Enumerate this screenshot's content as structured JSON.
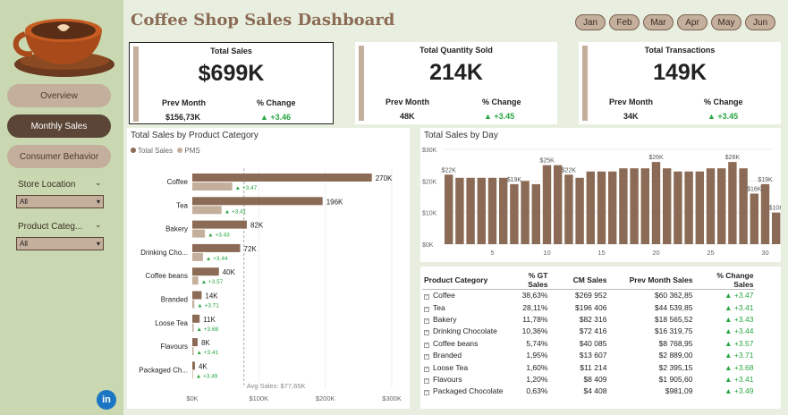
{
  "header": {
    "title": "Coffee Shop Sales Dashboard"
  },
  "months": [
    "Jan",
    "Feb",
    "Mar",
    "Apr",
    "May",
    "Jun"
  ],
  "nav": {
    "overview": "Overview",
    "monthly": "Monthly Sales",
    "behavior": "Consumer Behavior"
  },
  "filters": {
    "store": {
      "label": "Store Location",
      "value": "All"
    },
    "category": {
      "label": "Product Categ...",
      "value": "All"
    }
  },
  "social": {
    "icon": "linkedin-icon",
    "label": "in"
  },
  "kpis": [
    {
      "title": "Total Sales",
      "value": "$699K",
      "prev_label": "Prev Month",
      "prev_value": "$156,73K",
      "change_label": "% Change",
      "change_value": "▲ +3.46"
    },
    {
      "title": "Total Quantity Sold",
      "value": "214K",
      "prev_label": "Prev Month",
      "prev_value": "48K",
      "change_label": "% Change",
      "change_value": "▲ +3.45"
    },
    {
      "title": "Total Transactions",
      "value": "149K",
      "prev_label": "Prev Month",
      "prev_value": "34K",
      "change_label": "% Change",
      "change_value": "▲ +3.45"
    }
  ],
  "colors": {
    "total": "#8b6b55",
    "pms": "#c4ae9c",
    "up": "#2aa642",
    "sidebar": "#c9d8b0",
    "accent": "#5a4537"
  },
  "chart_data": [
    {
      "type": "bar",
      "title": "Total Sales by Product Category",
      "legend": [
        "Total Sales",
        "PMS"
      ],
      "categories": [
        "Coffee",
        "Tea",
        "Bakery",
        "Drinking Cho...",
        "Coffee beans",
        "Branded",
        "Loose Tea",
        "Flavours",
        "Packaged Ch..."
      ],
      "series": [
        {
          "name": "Total Sales",
          "values": [
            270,
            196,
            82,
            72,
            40,
            14,
            11,
            8,
            4
          ]
        },
        {
          "name": "PMS",
          "values": [
            60,
            44,
            19,
            16,
            9,
            3,
            2,
            2,
            1
          ]
        }
      ],
      "value_labels": [
        "270K",
        "196K",
        "82K",
        "72K",
        "40K",
        "14K",
        "11K",
        "8K",
        "4K"
      ],
      "change_labels": [
        "▲ +3.47",
        "▲ +3.41",
        "▲ +3.43",
        "▲ +3.44",
        "▲ +3.57",
        "▲ +3.71",
        "▲ +3.68",
        "▲ +3.41",
        "▲ +3.49"
      ],
      "xticks": [
        "$0K",
        "$100K",
        "$200K",
        "$300K"
      ],
      "xlim": [
        0,
        300
      ],
      "avg_line": {
        "value": 77.65,
        "label": "Avg Sales: $77,65K"
      }
    },
    {
      "type": "bar",
      "title": "Total Sales by Day",
      "x": [
        1,
        2,
        3,
        4,
        5,
        6,
        7,
        8,
        9,
        10,
        11,
        12,
        13,
        14,
        15,
        16,
        17,
        18,
        19,
        20,
        21,
        22,
        23,
        24,
        25,
        26,
        27,
        28,
        29,
        30,
        31
      ],
      "values": [
        22,
        21,
        21,
        21,
        21,
        21,
        19,
        20,
        19,
        25,
        25,
        22,
        21,
        23,
        23,
        23,
        24,
        24,
        24,
        26,
        24,
        23,
        23,
        23,
        24,
        24,
        26,
        24,
        16,
        19,
        10
      ],
      "point_labels": [
        {
          "day": 1,
          "label": "$22K"
        },
        {
          "day": 7,
          "label": "$19K"
        },
        {
          "day": 10,
          "label": "$25K"
        },
        {
          "day": 12,
          "label": "$22K"
        },
        {
          "day": 20,
          "label": "$26K"
        },
        {
          "day": 27,
          "label": "$26K"
        },
        {
          "day": 29,
          "label": "$16K"
        },
        {
          "day": 30,
          "label": "$19K"
        },
        {
          "day": 31,
          "label": "$10K"
        }
      ],
      "yticks": [
        "$0K",
        "$10K",
        "$20K",
        "$30K"
      ],
      "ylim": [
        0,
        30
      ],
      "xticks": [
        "5",
        "10",
        "15",
        "20",
        "25",
        "30"
      ]
    }
  ],
  "table": {
    "headers": [
      "Product Category",
      "% GT Sales",
      "CM Sales",
      "Prev Month Sales",
      "% Change Sales"
    ],
    "rows": [
      [
        "Coffee",
        "38,63%",
        "$269 952",
        "$60 362,85",
        "▲ +3.47"
      ],
      [
        "Tea",
        "28,11%",
        "$196 406",
        "$44 539,85",
        "▲ +3.41"
      ],
      [
        "Bakery",
        "11,78%",
        "$82 316",
        "$18 565,52",
        "▲ +3.43"
      ],
      [
        "Drinking Chocolate",
        "10,36%",
        "$72 416",
        "$16 319,75",
        "▲ +3.44"
      ],
      [
        "Coffee beans",
        "5,74%",
        "$40 085",
        "$8 768,95",
        "▲ +3.57"
      ],
      [
        "Branded",
        "1,95%",
        "$13 607",
        "$2 889,00",
        "▲ +3.71"
      ],
      [
        "Loose Tea",
        "1,60%",
        "$11 214",
        "$2 395,15",
        "▲ +3.68"
      ],
      [
        "Flavours",
        "1,20%",
        "$8 409",
        "$1 905,60",
        "▲ +3.41"
      ],
      [
        "Packaged Chocolate",
        "0,63%",
        "$4 408",
        "$981,09",
        "▲ +3.49"
      ]
    ]
  }
}
